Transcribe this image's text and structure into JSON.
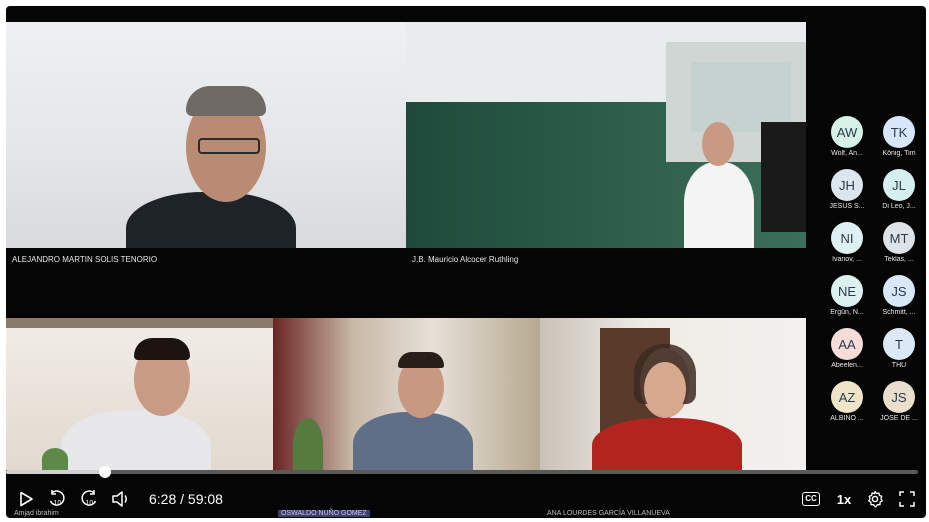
{
  "tiles": [
    {
      "name": "ALEJANDRO MARTIN SOLIS TENORIO"
    },
    {
      "name": "J.B. Mauricio Alcocer Ruthling"
    }
  ],
  "bottom_names": {
    "left": "Amjad ibrahim",
    "middle": "OSWALDO NUÑO GOMEZ",
    "right": "ANA LOURDES GARCÍA VILLANUEVA"
  },
  "participants": [
    {
      "initials": "AW",
      "label": "Wolf, An...",
      "color": "#d6f2e6"
    },
    {
      "initials": "TK",
      "label": "König, Tim",
      "color": "#d7e6f8"
    },
    {
      "initials": "JH",
      "label": "JESÚS S...",
      "color": "#dbe6ef"
    },
    {
      "initials": "JL",
      "label": "Di Leo, J...",
      "color": "#d5eef0"
    },
    {
      "initials": "NI",
      "label": "Ivanov, ...",
      "color": "#dff0f3"
    },
    {
      "initials": "MT",
      "label": "Teklas, ...",
      "color": "#dde3e6"
    },
    {
      "initials": "NE",
      "label": "Ergün, N...",
      "color": "#dbf0ef"
    },
    {
      "initials": "JS",
      "label": "Schmitt, ...",
      "color": "#d8e8f8"
    },
    {
      "initials": "AA",
      "label": "Abeelen...",
      "color": "#f5dcd8"
    },
    {
      "initials": "T",
      "label": "THU",
      "color": "#dbe8f6"
    },
    {
      "initials": "AZ",
      "label": "ALBINO ...",
      "color": "#efe3c8"
    },
    {
      "initials": "JS",
      "label": "JOSE DE ...",
      "color": "#eadfcc"
    }
  ],
  "player": {
    "time_current": "6:28",
    "time_separator": " / ",
    "time_total": "59:08",
    "progress": 0.109,
    "speed": "1x",
    "cc_label": "CC"
  }
}
